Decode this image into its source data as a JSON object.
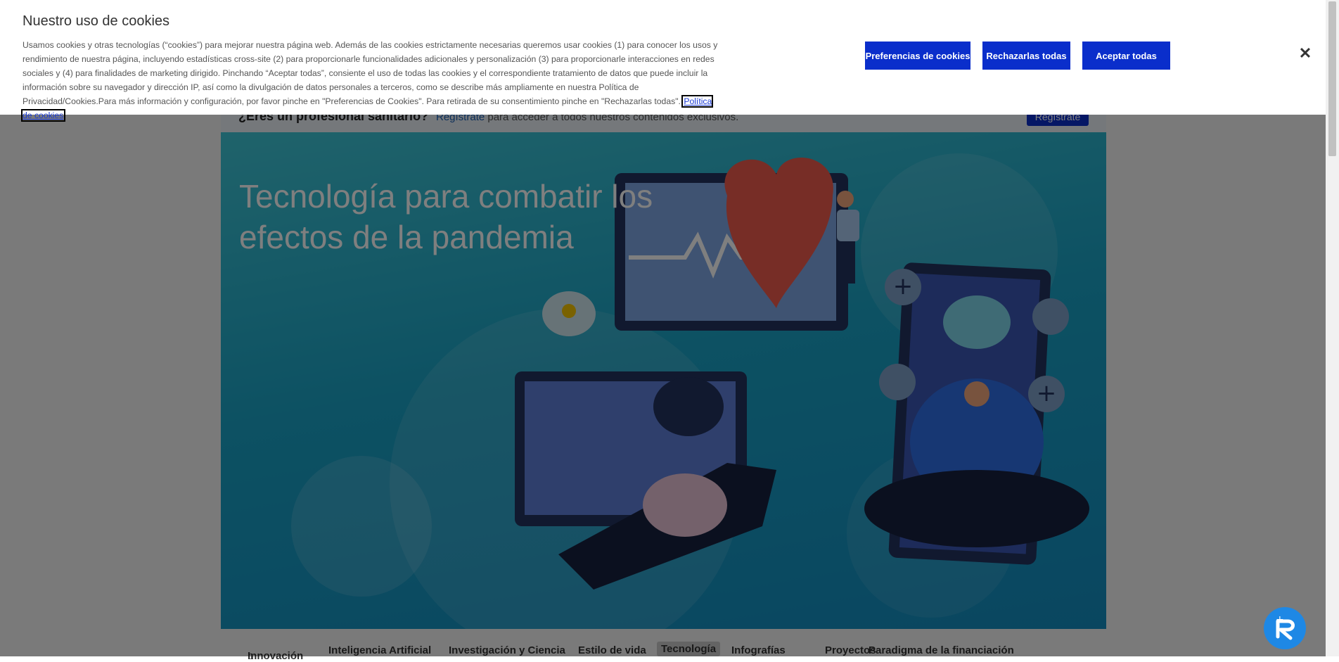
{
  "cookie_banner": {
    "title": "Nuestro uso de cookies",
    "description": "Usamos cookies y otras tecnologías (“cookies”) para mejorar nuestra página web. Además de las cookies estrictamente necesarias queremos usar cookies (1) para conocer los usos y rendimiento de nuestra página, incluyendo estadísticas cross-site (2) para proporcionarle funcionalidades adicionales y personalización (3) para proporcionarle interacciones en redes sociales y (4) para finalidades de marketing dirigido. Pinchando “Aceptar todas”, consiente el uso de todas las cookies y el correspondiente tratamiento de datos que puede incluir la información sobre su navegador y dirección IP, así como la divulgación de datos personales a terceros, como se describe más ampliamente en nuestra Política de Privacidad/Cookies.Para más información y configuración, por favor pinche en \"Preferencias de Cookies\". Para retirada de su consentimiento pinche en \"Rechazarlas todas\".",
    "policy_link": "Política de cookies",
    "buttons": {
      "preferences": "Preferencias de cookies",
      "reject": "Rechazarlas todas",
      "accept": "Aceptar todas"
    },
    "close_icon": "close-icon"
  },
  "pro_bar": {
    "question": "¿Eres un profesional sanitario?",
    "link": "Regístrate",
    "rest": " para acceder a todos nuestros contenidos exclusivos.",
    "button": "Regístrate"
  },
  "hero": {
    "title": "Tecnología para combatir los efectos de la pandemia"
  },
  "nav": {
    "items": [
      "Innovación",
      "Inteligencia Artificial",
      "Investigación y Ciencia",
      "Estilo de vida",
      "Tecnología",
      "Infografías",
      "Proyectos",
      "Paradigma de la financiación"
    ],
    "active": "Tecnología"
  },
  "colors": {
    "primary_button": "#0a2ecb",
    "hero_bg": "#1aa3c6",
    "chat_widget": "#1e88e5"
  }
}
